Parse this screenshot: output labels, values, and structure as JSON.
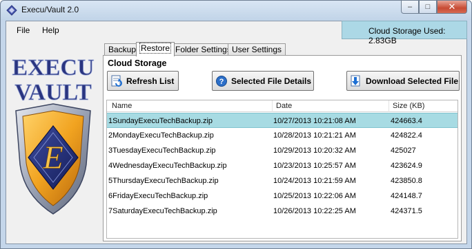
{
  "window": {
    "title": "Execu/Vault 2.0",
    "controls": {
      "minimize": "–",
      "maximize": "□",
      "close": "✕"
    }
  },
  "menu": [
    {
      "label": "File"
    },
    {
      "label": "Help"
    }
  ],
  "storage": {
    "label": "Cloud Storage Used: 2.83GB",
    "color": "#acd8e6"
  },
  "logo": {
    "line1": "EXECU",
    "line2": "VAULT",
    "emblem_letter": "E"
  },
  "tabs": [
    {
      "label": "Backup",
      "active": false
    },
    {
      "label": "Restore",
      "active": true
    },
    {
      "label": "Folder Settings",
      "active": false
    },
    {
      "label": "User Settings",
      "active": false
    }
  ],
  "panel": {
    "title": "Cloud Storage",
    "buttons": {
      "refresh": {
        "label": "Refresh List",
        "icon": "refresh-icon"
      },
      "details": {
        "label": "Selected File Details",
        "icon": "help-icon"
      },
      "download": {
        "label": "Download Selected File",
        "icon": "download-icon"
      }
    }
  },
  "table": {
    "columns": [
      "Name",
      "Date",
      "Size (KB)"
    ],
    "rows": [
      {
        "name": "1SundayExecuTechBackup.zip",
        "date": "10/27/2013 10:21:08 AM",
        "size": "424663.4",
        "selected": true
      },
      {
        "name": "2MondayExecuTechBackup.zip",
        "date": "10/28/2013 10:21:21 AM",
        "size": "424822.4",
        "selected": false
      },
      {
        "name": "3TuesdayExecuTechBackup.zip",
        "date": "10/29/2013 10:20:32 AM",
        "size": "425027",
        "selected": false
      },
      {
        "name": "4WednesdayExecuTechBackup.zip",
        "date": "10/23/2013 10:25:57 AM",
        "size": "423624.9",
        "selected": false
      },
      {
        "name": "5ThursdayExecuTechBackup.zip",
        "date": "10/24/2013 10:21:59 AM",
        "size": "423850.8",
        "selected": false
      },
      {
        "name": "6FridayExecuTechBackup.zip",
        "date": "10/25/2013 10:22:06 AM",
        "size": "424148.7",
        "selected": false
      },
      {
        "name": "7SaturdayExecuTechBackup.zip",
        "date": "10/26/2013 10:22:25 AM",
        "size": "424371.5",
        "selected": false
      }
    ]
  }
}
